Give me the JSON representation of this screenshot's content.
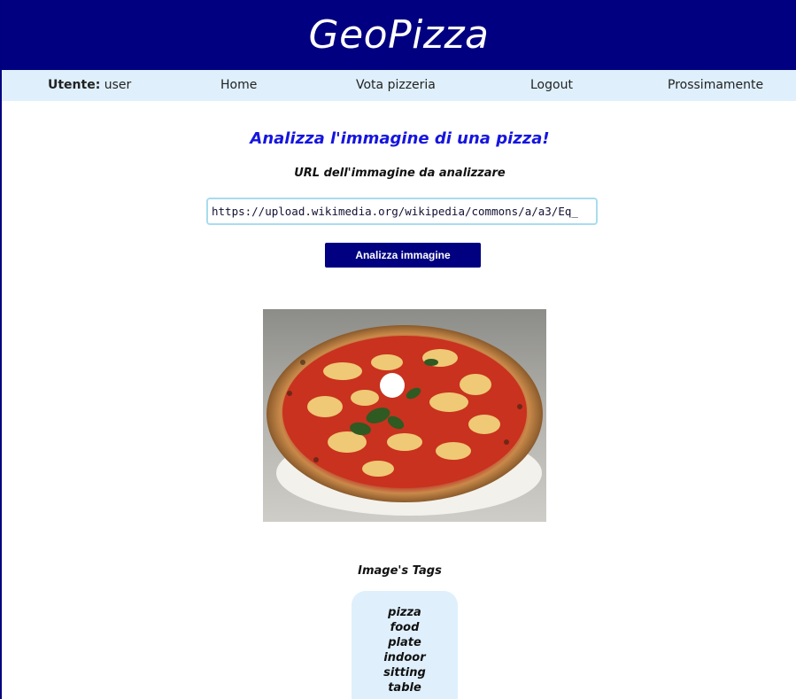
{
  "header": {
    "brand": "GeoPizza"
  },
  "nav": {
    "user_label": "Utente:",
    "user_name": "user",
    "home": "Home",
    "vota": "Vota pizzeria",
    "logout": "Logout",
    "prossimamente": "Prossimamente"
  },
  "main": {
    "title": "Analizza l'immagine di una pizza!",
    "url_label": "URL dell'immagine da analizzare",
    "url_value": "https://upload.wikimedia.org/wikipedia/commons/a/a3/Eq_",
    "analyze_button": "Analizza immagine"
  },
  "tags": {
    "title": "Image's Tags",
    "items": [
      "pizza",
      "food",
      "plate",
      "indoor",
      "sitting",
      "table"
    ]
  },
  "colors": {
    "header_bg": "#000080",
    "nav_bg": "#dff0fc",
    "title_blue": "#1515e0"
  }
}
